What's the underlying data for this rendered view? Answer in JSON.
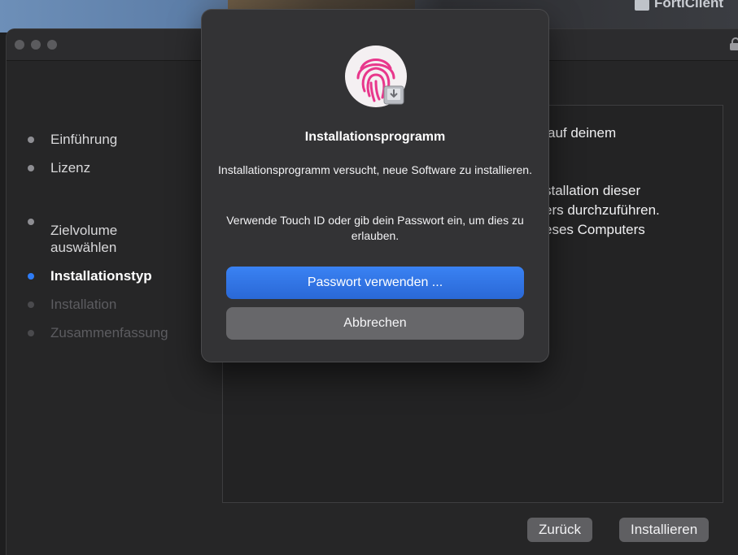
{
  "desktop": {
    "app_label": "FortiClient"
  },
  "sidebar": {
    "steps": [
      {
        "label": "Einführung",
        "state": "done"
      },
      {
        "label": "Lizenz",
        "state": "done"
      },
      {
        "label": "Zielvolume\nauswählen",
        "state": "done"
      },
      {
        "label": "Installationstyp",
        "state": "active"
      },
      {
        "label": "Installation",
        "state": "disabled"
      },
      {
        "label": "Zusammenfassung",
        "state": "disabled"
      }
    ]
  },
  "content": {
    "line1": "auf deinem",
    "line2": "stallation dieser",
    "line3": "ers durchzuführen.",
    "line4": "eses Computers"
  },
  "footer": {
    "back_label": "Zurück",
    "install_label": "Installieren"
  },
  "dialog": {
    "title": "Installationsprogramm",
    "message": "Installationsprogramm versucht, neue Software zu installieren.",
    "message2": "Verwende Touch ID oder gib dein Passwort ein, um dies zu erlauben.",
    "primary_label": "Passwort verwenden ...",
    "cancel_label": "Abbrechen",
    "icon": "touch-id-fingerprint-icon"
  },
  "colors": {
    "accent": "#2E7CF6",
    "fingerprint": "#E8378C",
    "window_bg": "#262627",
    "dialog_bg": "#333335"
  }
}
